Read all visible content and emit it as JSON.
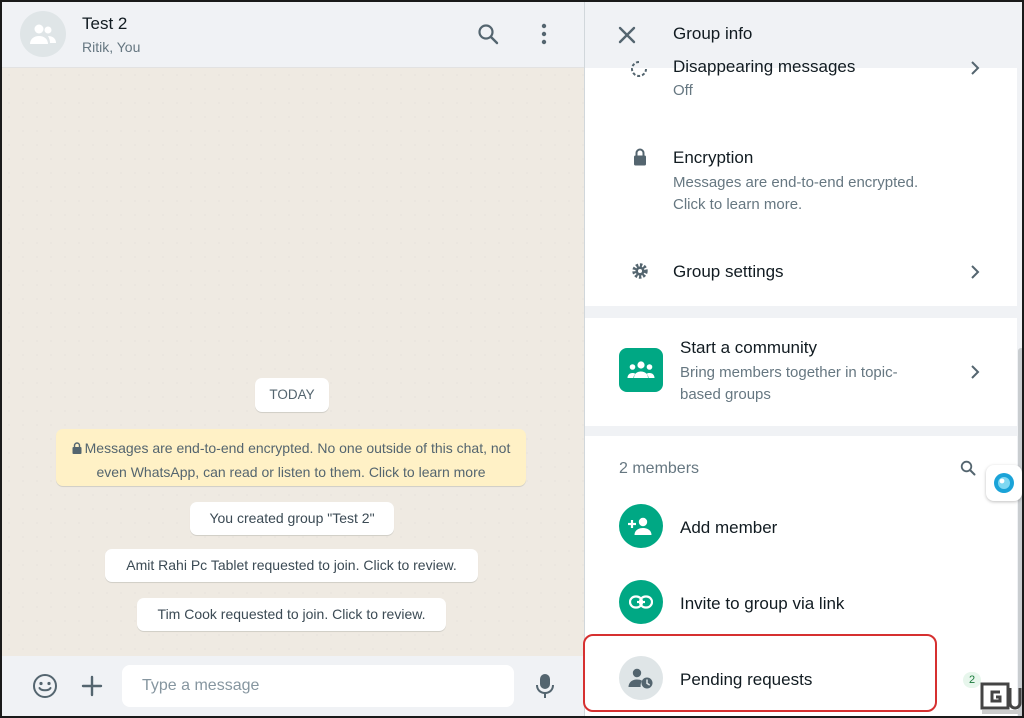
{
  "chat": {
    "title": "Test 2",
    "participants": "Ritik, You",
    "date_chip": "TODAY",
    "encryption_notice": "Messages are end-to-end encrypted. No one outside of this chat, not even WhatsApp, can read or listen to them. Click to learn more",
    "system_messages": [
      "You created group \"Test 2\"",
      "Amit Rahi Pc Tablet requested to join. Click to review.",
      "Tim Cook requested to join. Click to review."
    ],
    "composer_placeholder": "Type a message"
  },
  "group_info": {
    "title": "Group info",
    "disappearing": {
      "label": "Disappearing messages",
      "value": "Off"
    },
    "encryption": {
      "label": "Encryption",
      "desc_line1": "Messages are end-to-end encrypted.",
      "desc_line2": "Click to learn more."
    },
    "group_settings": "Group settings",
    "community": {
      "label": "Start a community",
      "desc_line1": "Bring members together in topic-",
      "desc_line2": "based groups"
    },
    "members_count": "2 members",
    "add_member": "Add member",
    "invite_link": "Invite to group via link",
    "pending_requests": "Pending requests"
  },
  "badge_count": "2",
  "colors": {
    "accent_green": "#00a884",
    "highlight_red": "#d63030",
    "notice_yellow": "#fff1c6"
  },
  "icons": [
    "group-avatar-icon",
    "search-icon",
    "more-vertical-icon",
    "lock-icon",
    "emoji-icon",
    "plus-icon",
    "mic-icon",
    "close-icon",
    "timer-icon",
    "gear-icon",
    "chevron-right-icon",
    "community-icon",
    "add-person-icon",
    "link-icon",
    "pending-person-icon"
  ]
}
